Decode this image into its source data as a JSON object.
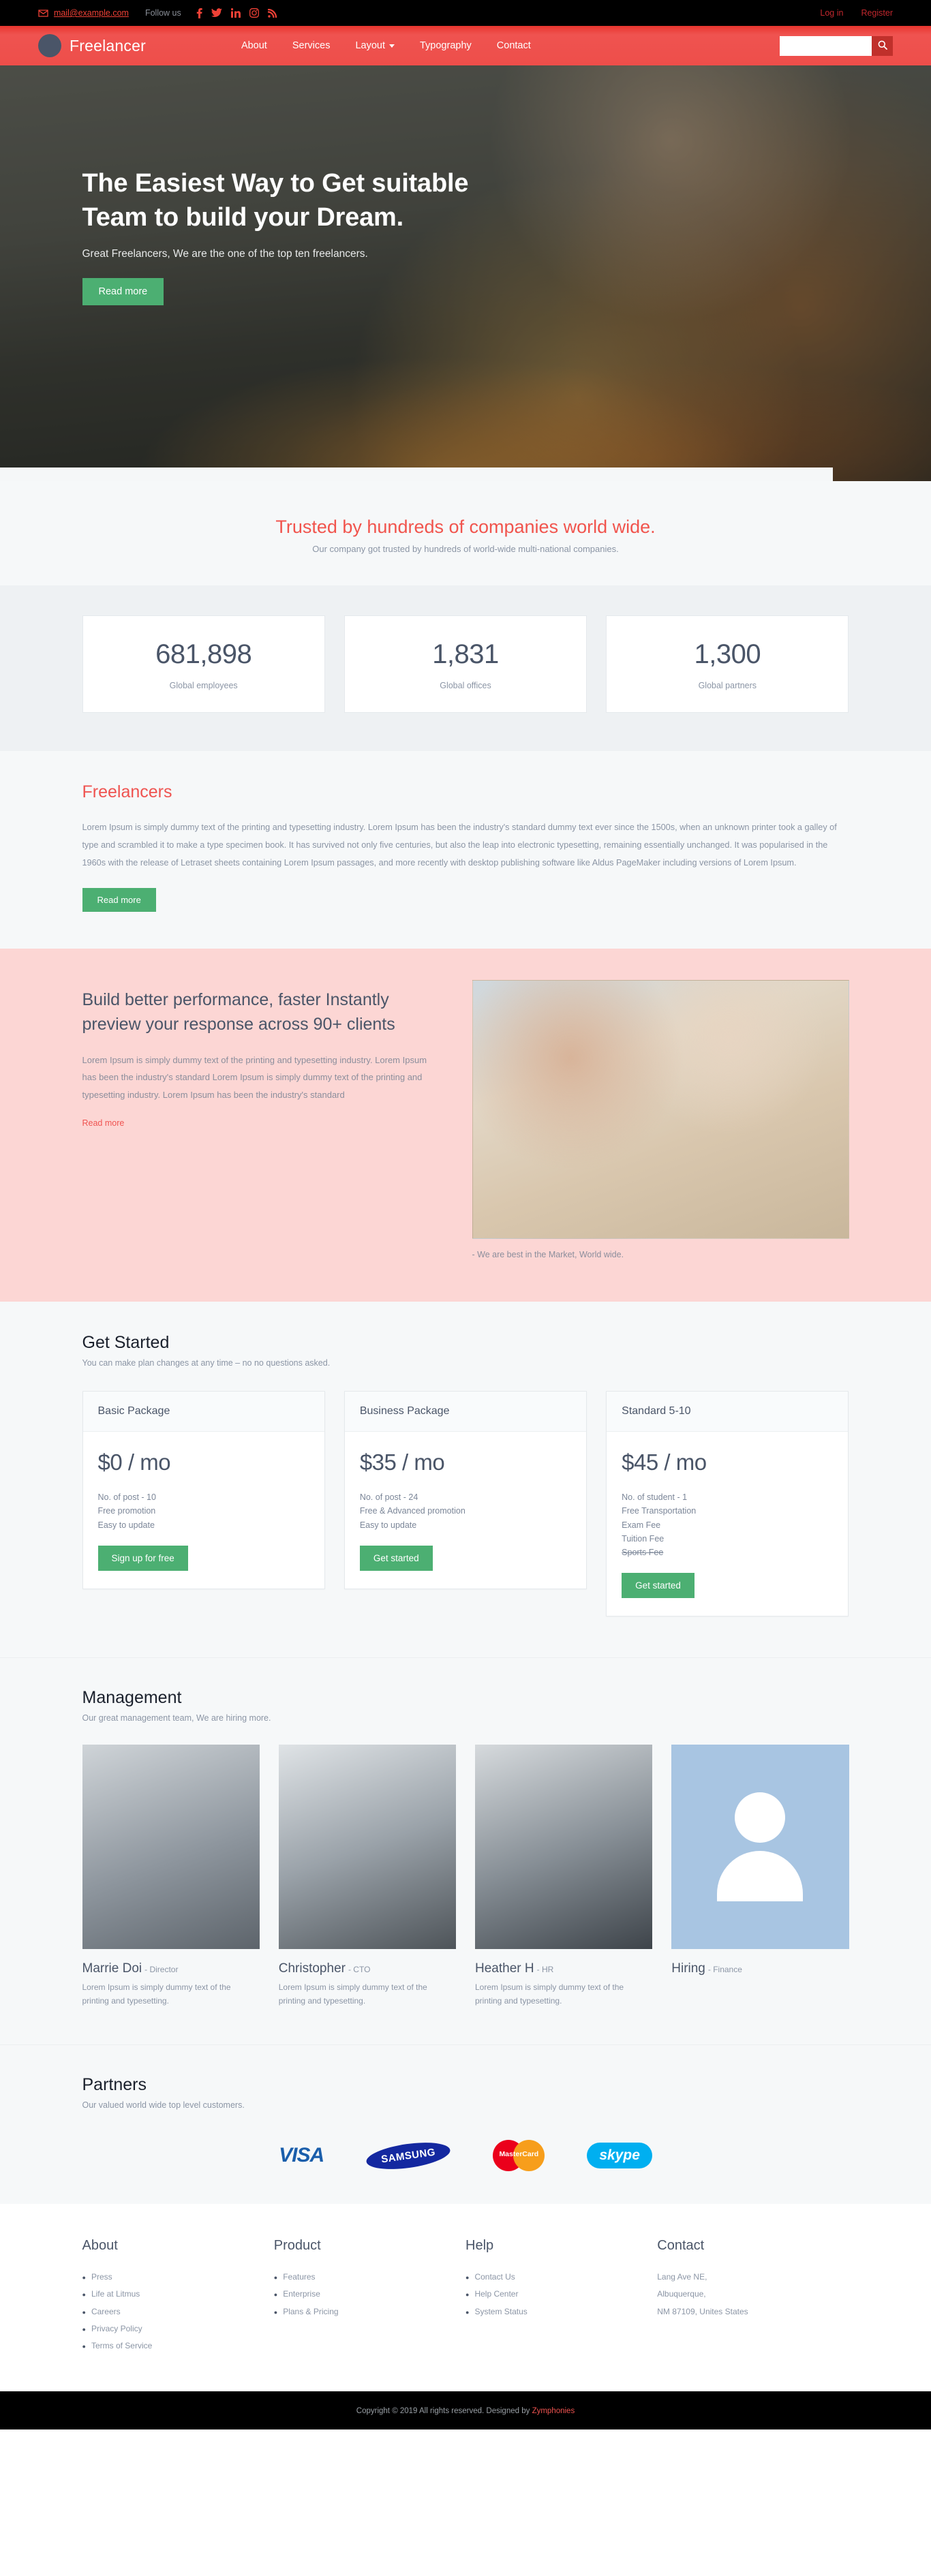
{
  "topbar": {
    "email": "mail@example.com",
    "follow_label": "Follow us",
    "mail_icon": "envelope-icon",
    "socials": [
      {
        "name": "facebook-icon",
        "glyph": "f"
      },
      {
        "name": "twitter-icon",
        "glyph": "t"
      },
      {
        "name": "linkedin-icon",
        "glyph": "in"
      },
      {
        "name": "instagram-icon",
        "glyph": "ig"
      },
      {
        "name": "rss-icon",
        "glyph": "rss"
      }
    ],
    "login_label": "Log in",
    "register_label": "Register"
  },
  "navbar": {
    "brand": "Freelancer",
    "links": [
      {
        "label": "About",
        "has_caret": false
      },
      {
        "label": "Services",
        "has_caret": false
      },
      {
        "label": "Layout",
        "has_caret": true
      },
      {
        "label": "Typography",
        "has_caret": false
      },
      {
        "label": "Contact",
        "has_caret": false
      }
    ],
    "search_value": "",
    "search_placeholder": "",
    "search_icon": "search-icon"
  },
  "hero": {
    "title": "The Easiest Way to Get suitable Team to build your Dream.",
    "subtitle": "Great Freelancers, We are the one of the top ten freelancers.",
    "button": "Read more"
  },
  "trusted": {
    "title": "Trusted by hundreds of companies world wide.",
    "subtitle": "Our company got trusted by hundreds of world-wide multi-national companies."
  },
  "stats": [
    {
      "value": "681,898",
      "label": "Global employees"
    },
    {
      "value": "1,831",
      "label": "Global offices"
    },
    {
      "value": "1,300",
      "label": "Global partners"
    }
  ],
  "freelancers": {
    "title": "Freelancers",
    "body": "Lorem Ipsum is simply dummy text of the printing and typesetting industry. Lorem Ipsum has been the industry's standard dummy text ever since the 1500s, when an unknown printer took a galley of type and scrambled it to make a type specimen book. It has survived not only five centuries, but also the leap into electronic typesetting, remaining essentially unchanged. It was popularised in the 1960s with the release of Letraset sheets containing Lorem Ipsum passages, and more recently with desktop publishing software like Aldus PageMaker including versions of Lorem Ipsum.",
    "button": "Read more"
  },
  "performance": {
    "title": "Build better performance, faster Instantly preview your response across 90+ clients",
    "body": "Lorem Ipsum is simply dummy text of the printing and typesetting industry. Lorem Ipsum has been the industry's standard Lorem Ipsum is simply dummy text of the printing and typesetting industry. Lorem Ipsum has been the industry's standard",
    "link": "Read more",
    "caption": "- We are best in the Market, World wide."
  },
  "pricing": {
    "title": "Get Started",
    "subtitle": "You can make plan changes at any time – no no questions asked.",
    "plans": [
      {
        "name": "Basic Package",
        "price": "$0 / mo",
        "features": [
          {
            "text": "No. of post - 10",
            "strike": false
          },
          {
            "text": "Free promotion",
            "strike": false
          },
          {
            "text": "Easy to update",
            "strike": false
          }
        ],
        "button": "Sign up for free"
      },
      {
        "name": "Business Package",
        "price": "$35 / mo",
        "features": [
          {
            "text": "No. of post - 24",
            "strike": false
          },
          {
            "text": "Free & Advanced promotion",
            "strike": false
          },
          {
            "text": "Easy to update",
            "strike": false
          }
        ],
        "button": "Get started"
      },
      {
        "name": "Standard 5-10",
        "price": "$45 / mo",
        "features": [
          {
            "text": "No. of student - 1",
            "strike": false
          },
          {
            "text": "Free Transportation",
            "strike": false
          },
          {
            "text": "Exam Fee",
            "strike": false
          },
          {
            "text": "Tuition Fee",
            "strike": false
          },
          {
            "text": "Sports Fee",
            "strike": true
          }
        ],
        "button": "Get started"
      }
    ]
  },
  "management": {
    "title": "Management",
    "subtitle": "Our great management team, We are hiring more.",
    "members": [
      {
        "name": "Marrie Doi",
        "role": "- Director",
        "desc": "Lorem Ipsum is simply dummy text of the printing and typesetting."
      },
      {
        "name": "Christopher",
        "role": "- CTO",
        "desc": "Lorem Ipsum is simply dummy text of the printing and typesetting."
      },
      {
        "name": "Heather H",
        "role": "- HR",
        "desc": "Lorem Ipsum is simply dummy text of the printing and typesetting."
      },
      {
        "name": "Hiring",
        "role": "- Finance",
        "desc": ""
      }
    ]
  },
  "partners": {
    "title": "Partners",
    "subtitle": "Our valued world wide top level customers.",
    "logos": [
      {
        "name": "visa-logo",
        "text": "VISA"
      },
      {
        "name": "samsung-logo",
        "text": "SAMSUNG"
      },
      {
        "name": "mastercard-logo",
        "text": "MasterCard"
      },
      {
        "name": "skype-logo",
        "text": "skype"
      }
    ]
  },
  "footer": {
    "columns": [
      {
        "title": "About",
        "items": [
          "Press",
          "Life at Litmus",
          "Careers",
          "Privacy Policy",
          "Terms of Service"
        ]
      },
      {
        "title": "Product",
        "items": [
          "Features",
          "Enterprise",
          "Plans & Pricing"
        ]
      },
      {
        "title": "Help",
        "items": [
          "Contact Us",
          "Help Center",
          "System Status"
        ]
      }
    ],
    "contact": {
      "title": "Contact",
      "lines": [
        "Lang Ave NE,",
        "Albuquerque,",
        "NM 87109, Unites States"
      ]
    }
  },
  "copyright": {
    "text": "Copyright © 2019 All rights reserved. Designed by ",
    "link": "Zymphonies"
  },
  "colors": {
    "brand_red": "#ef5350",
    "accent_green": "#4caf72",
    "dark_text": "#4a5568",
    "muted_text": "#8b95a5",
    "pink_bg": "#fcd6d4"
  }
}
